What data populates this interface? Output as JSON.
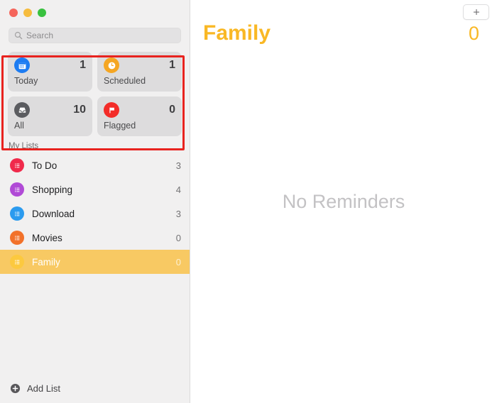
{
  "window": {
    "traffic_lights": [
      {
        "name": "close",
        "color": "#f5655b"
      },
      {
        "name": "minimize",
        "color": "#f6bc3e"
      },
      {
        "name": "maximize",
        "color": "#39c13f"
      }
    ]
  },
  "search": {
    "placeholder": "Search",
    "value": "",
    "icon": "search-icon"
  },
  "smart_lists": [
    {
      "label": "Today",
      "count": "1",
      "icon": "calendar-icon",
      "color": "#1d7cf2"
    },
    {
      "label": "Scheduled",
      "count": "1",
      "icon": "clock-icon",
      "color": "#f5a623"
    },
    {
      "label": "All",
      "count": "10",
      "icon": "inbox-icon",
      "color": "#5b5c60"
    },
    {
      "label": "Flagged",
      "count": "0",
      "icon": "flag-icon",
      "color": "#f32c28"
    }
  ],
  "sidebar": {
    "section_title": "My Lists",
    "lists": [
      {
        "label": "To Do",
        "count": "3",
        "color": "#f02a4b",
        "icon": "list-icon",
        "selected": false
      },
      {
        "label": "Shopping",
        "count": "4",
        "color": "#b04ad6",
        "icon": "list-icon",
        "selected": false
      },
      {
        "label": "Download",
        "count": "3",
        "color": "#2b9bef",
        "icon": "list-icon",
        "selected": false
      },
      {
        "label": "Movies",
        "count": "0",
        "color": "#f2712a",
        "icon": "list-icon",
        "selected": false
      },
      {
        "label": "Family",
        "count": "0",
        "color": "#fcc93f",
        "icon": "list-icon",
        "selected": true
      }
    ],
    "add_list_label": "Add List",
    "add_list_icon": "plus-circle-icon",
    "selected_row_color": "#f8c963"
  },
  "main": {
    "title": "Family",
    "count": "0",
    "title_color": "#f9b825",
    "empty_message": "No Reminders",
    "add_button_icon": "plus-icon"
  },
  "annotation": {
    "color": "#e8231f",
    "target": "smart-lists-grid"
  }
}
